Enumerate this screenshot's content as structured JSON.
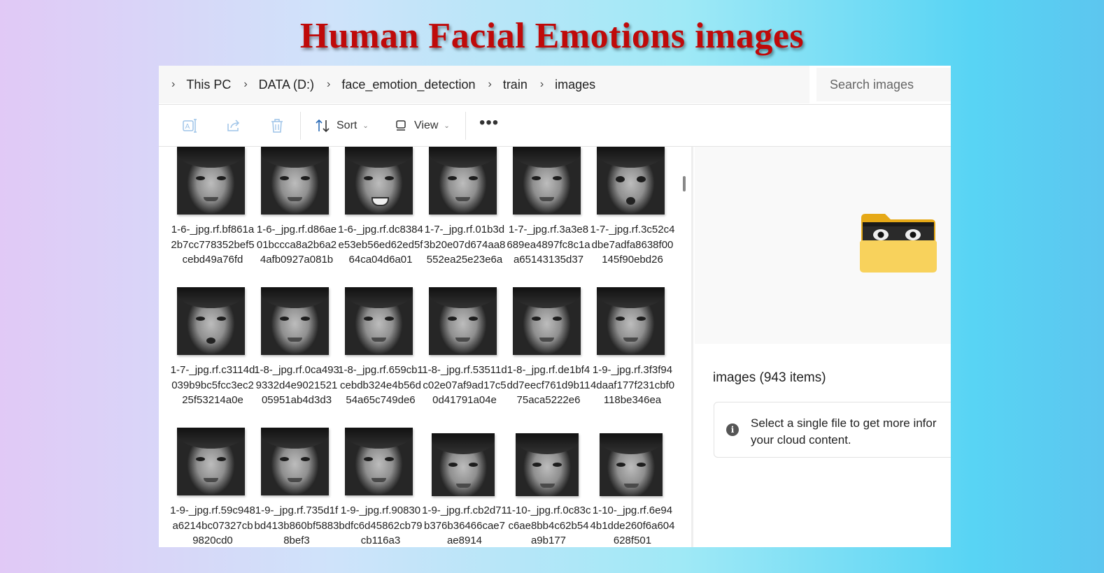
{
  "banner_title": "Human Facial Emotions images",
  "breadcrumb": {
    "chevron": "›",
    "items": [
      "This PC",
      "DATA (D:)",
      "face_emotion_detection",
      "train",
      "images"
    ]
  },
  "search": {
    "placeholder": "Search images"
  },
  "toolbar": {
    "icons": [
      "rename-icon",
      "share-icon",
      "delete-icon"
    ],
    "sort_label": "Sort",
    "view_label": "View",
    "more_label": "•••",
    "caret": "⌄"
  },
  "files": [
    {
      "name": "1-6-_jpg.rf.bf861a2b7cc778352bef5cebd49a76fd"
    },
    {
      "name": "1-6-_jpg.rf.d86ae01bccca8a2b6a24afb0927a081b"
    },
    {
      "name": "1-6-_jpg.rf.dc8384e53eb56ed62ed5f64ca04d6a01"
    },
    {
      "name": "1-7-_jpg.rf.01b3d3b20e07d674aa8552ea25e23e6a"
    },
    {
      "name": "1-7-_jpg.rf.3a3e8689ea4897fc8c1aa65143135d37"
    },
    {
      "name": "1-7-_jpg.rf.3c52c4dbe7adfa8638f00145f90ebd26"
    },
    {
      "name": "1-7-_jpg.rf.c3114d039b9bc5fcc3ec225f53214a0e"
    },
    {
      "name": "1-8-_jpg.rf.0ca4939332d4e902152105951ab4d3d3"
    },
    {
      "name": "1-8-_jpg.rf.659cb1cebdb324e4b56d54a65c749de6"
    },
    {
      "name": "1-8-_jpg.rf.53511dc02e07af9ad17c50d41791a04e"
    },
    {
      "name": "1-8-_jpg.rf.de1bf4dd7eecf761d9b1175aca5222e6"
    },
    {
      "name": "1-9-_jpg.rf.3f3f944daaf177f231cbf0118be346ea"
    },
    {
      "name": "1-9-_jpg.rf.59c948a6214bc07327cb9820cd0"
    },
    {
      "name": "1-9-_jpg.rf.735d1fbd413b860bf58838bef3"
    },
    {
      "name": "1-9-_jpg.rf.90830bdfc6d45862cb79cb116a3"
    },
    {
      "name": "1-9-_jpg.rf.cb2d71b376b36466cae7ae8914"
    },
    {
      "name": "1-10-_jpg.rf.0c83cc6ae8bb4c62b54a9b177"
    },
    {
      "name": "1-10-_jpg.rf.6e944b1dde260f6a604628f501"
    }
  ],
  "details": {
    "title": "images (943 items)",
    "info_icon": "i",
    "info_text_line1": "Select a single file to get more infor",
    "info_text_line2": "your cloud content."
  },
  "colors": {
    "banner": "#bf0a0a",
    "folder_back": "#e6a917",
    "folder_front": "#f8d25c"
  }
}
